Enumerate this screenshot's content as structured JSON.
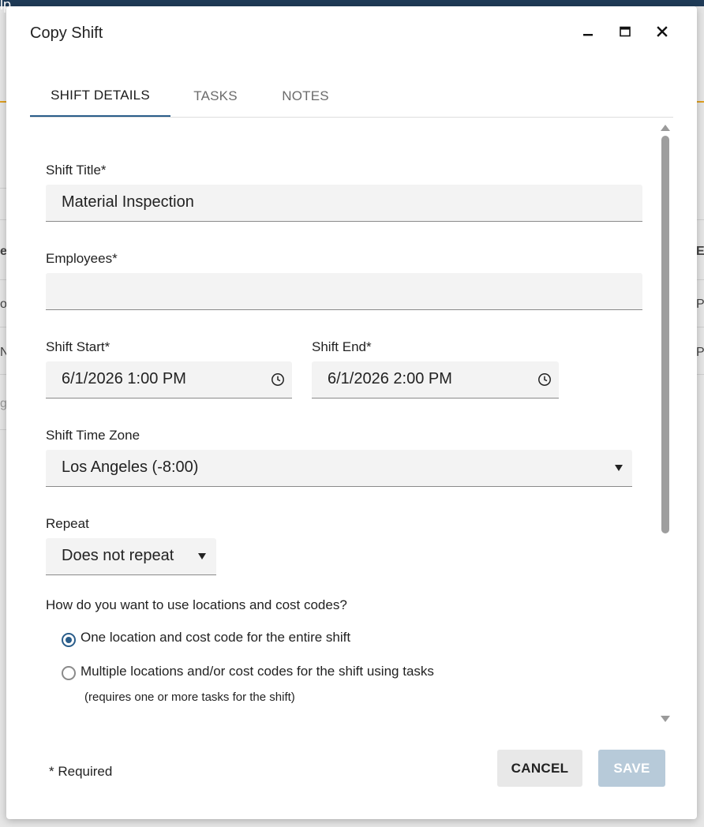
{
  "background": {
    "fragments": [
      "e",
      "oo",
      "N",
      "g",
      "E",
      "P",
      "P"
    ]
  },
  "dialog": {
    "title": "Copy Shift",
    "controls": {
      "minimize_icon": "minimize-icon",
      "maximize_icon": "maximize-icon",
      "close_icon": "close-icon"
    },
    "tabs": [
      {
        "label": "SHIFT DETAILS",
        "active": true
      },
      {
        "label": "TASKS",
        "active": false
      },
      {
        "label": "NOTES",
        "active": false
      }
    ]
  },
  "form": {
    "shift_title": {
      "label": "Shift Title*",
      "value": "Material Inspection"
    },
    "employees": {
      "label": "Employees*",
      "value": ""
    },
    "shift_start": {
      "label": "Shift Start*",
      "value": "6/1/2026 1:00 PM"
    },
    "shift_end": {
      "label": "Shift End*",
      "value": "6/1/2026 2:00 PM"
    },
    "time_zone": {
      "label": "Shift Time Zone",
      "value": "Los Angeles (-8:00)"
    },
    "repeat": {
      "label": "Repeat",
      "value": "Does not repeat"
    },
    "location_question": "How do you want to use locations and cost codes?",
    "location_options": [
      {
        "label": "One location and cost code for the entire shift",
        "selected": true
      },
      {
        "label": "Multiple locations and/or cost codes for the shift using tasks",
        "note": "(requires one or more tasks for the shift)",
        "selected": false
      }
    ]
  },
  "footer": {
    "required_note": "* Required",
    "cancel_label": "CANCEL",
    "save_label": "SAVE"
  },
  "colors": {
    "accent": "#2a5d8a",
    "save_disabled": "#b7cad9",
    "field_bg": "#f3f3f3",
    "topbar": "#1f3b57"
  }
}
